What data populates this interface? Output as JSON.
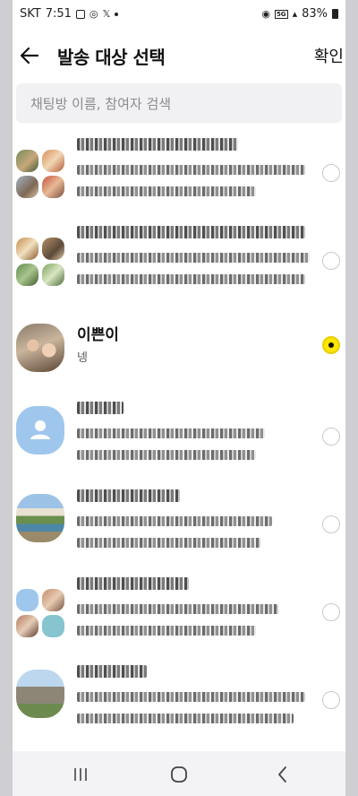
{
  "status_bar": {
    "carrier": "SKT",
    "time": "7:51",
    "network": "5G",
    "battery": "83%"
  },
  "header": {
    "title": "발송 대상 선택",
    "confirm_label": "확인"
  },
  "search": {
    "placeholder": "채팅방 이름, 참여자 검색"
  },
  "chats": [
    {
      "name": "",
      "preview": "",
      "avatar": "group",
      "selected": false
    },
    {
      "name": "",
      "preview": "",
      "avatar": "group",
      "selected": false
    },
    {
      "name": "이쁜이",
      "preview": "넹",
      "avatar": "photo-couple",
      "selected": true
    },
    {
      "name": "",
      "preview": "",
      "avatar": "default-person",
      "selected": false
    },
    {
      "name": "",
      "preview": "",
      "avatar": "photo-landscape",
      "selected": false
    },
    {
      "name": "",
      "preview": "",
      "avatar": "group",
      "selected": false
    },
    {
      "name": "",
      "preview": "",
      "avatar": "photo-mountain",
      "selected": false
    }
  ],
  "colors": {
    "accent": "#fee500",
    "default_avatar": "#9fc7ee"
  }
}
